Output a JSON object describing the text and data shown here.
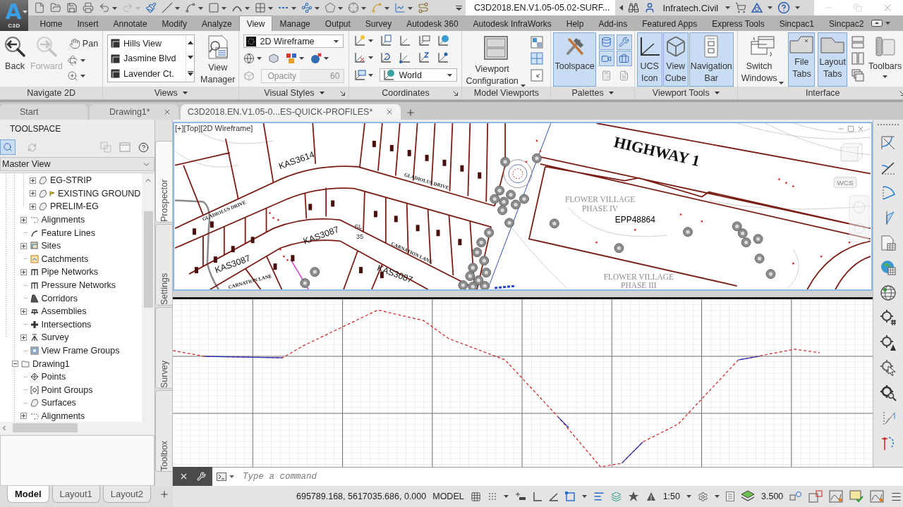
{
  "app_button": {
    "logo": "A",
    "label": "C3D"
  },
  "quick_access": {
    "tools": [
      {
        "kind": "new",
        "menu": false,
        "disabled": false
      },
      {
        "kind": "open",
        "menu": false,
        "disabled": false
      },
      {
        "kind": "save",
        "menu": false,
        "disabled": false
      },
      {
        "kind": "print",
        "menu": false,
        "disabled": false
      },
      {
        "kind": "undo",
        "menu": true,
        "disabled": false
      },
      {
        "kind": "redo",
        "menu": true,
        "disabled": true
      },
      {
        "kind": "match",
        "menu": false,
        "disabled": false
      },
      {
        "kind": "line",
        "menu": true,
        "disabled": false
      },
      {
        "kind": "polyline",
        "menu": true,
        "disabled": false
      },
      {
        "kind": "rectangle",
        "menu": true,
        "disabled": false
      },
      {
        "kind": "arc",
        "menu": true,
        "disabled": false
      },
      {
        "kind": "hatch",
        "menu": true,
        "disabled": false
      },
      {
        "kind": "dashline",
        "menu": true,
        "disabled": false
      },
      {
        "kind": "nodes",
        "menu": true,
        "disabled": false
      },
      {
        "kind": "surface",
        "menu": true,
        "disabled": false
      },
      {
        "kind": "point",
        "menu": true,
        "disabled": false
      },
      {
        "kind": "curve",
        "menu": true,
        "disabled": false
      },
      {
        "kind": "profile",
        "menu": true,
        "disabled": false
      },
      {
        "kind": "road",
        "menu": false,
        "disabled": false
      }
    ]
  },
  "title_bar": {
    "document_title": "C3D2018.EN.V1.05-05.02-SURF...",
    "user": "Infratech.Civil"
  },
  "ribbon_tabs": [
    {
      "label": "Home",
      "selected": false
    },
    {
      "label": "Insert",
      "selected": false
    },
    {
      "label": "Annotate",
      "selected": false
    },
    {
      "label": "Modify",
      "selected": false
    },
    {
      "label": "Analyze",
      "selected": false
    },
    {
      "label": "View",
      "selected": true
    },
    {
      "label": "Manage",
      "selected": false
    },
    {
      "label": "Output",
      "selected": false
    },
    {
      "label": "Survey",
      "selected": false
    },
    {
      "label": "Autodesk 360",
      "selected": false
    },
    {
      "label": "Autodesk InfraWorks",
      "selected": false
    },
    {
      "label": "Help",
      "selected": false
    },
    {
      "label": "Add-ins",
      "selected": false
    },
    {
      "label": "Featured Apps",
      "selected": false
    },
    {
      "label": "Express Tools",
      "selected": false
    },
    {
      "label": "Sincpac1",
      "selected": false
    },
    {
      "label": "Sincpac2",
      "selected": false
    }
  ],
  "ribbon": {
    "navigate_2d": {
      "title": "Navigate 2D",
      "back": {
        "label": "Back",
        "disabled": false
      },
      "forward": {
        "label": "Forward",
        "disabled": true
      },
      "pan": "Pan"
    },
    "views": {
      "title": "Views",
      "items": [
        "Hills View",
        "Jasmine Blvd",
        "Lavender Ct."
      ],
      "manager": "View Manager"
    },
    "visual_styles": {
      "title": "Visual Styles",
      "style": "2D Wireframe",
      "opacity": {
        "label": "Opacity",
        "value": "60",
        "disabled": true
      }
    },
    "coordinates": {
      "title": "Coordinates",
      "ucs": "World"
    },
    "model_viewports": {
      "title": "Model Viewports",
      "configuration": "Viewport Configuration"
    },
    "palettes": {
      "title": "Palettes",
      "toolspace": {
        "label": "Toolspace",
        "selected": true
      },
      "tools": [
        {
          "kind": "database",
          "selected": true
        },
        {
          "kind": "wrenches",
          "selected": true
        },
        {
          "kind": "camera",
          "selected": true
        },
        {
          "kind": "toolbox",
          "selected": true
        },
        {
          "kind": "calculator",
          "selected": false
        },
        {
          "kind": "sheet",
          "selected": false
        }
      ]
    },
    "viewport_tools": {
      "title": "Viewport Tools",
      "buttons": [
        {
          "label": "UCS Icon",
          "kind": "ucs",
          "selected": true
        },
        {
          "label": "View Cube",
          "kind": "cube",
          "selected": true
        },
        {
          "label": "Navigation Bar",
          "kind": "navbar",
          "selected": true
        }
      ]
    },
    "interface": {
      "title": "Interface",
      "switch_windows": "Switch Windows",
      "tabs": [
        {
          "label": "File Tabs",
          "kind": "file",
          "selected": true
        },
        {
          "label": "Layout Tabs",
          "kind": "layout",
          "selected": true
        }
      ],
      "toolbars": "Toolbars"
    }
  },
  "file_tabs": [
    {
      "label": "Start",
      "selected": false,
      "closable": false
    },
    {
      "label": "Drawing1*",
      "selected": false,
      "closable": true
    },
    {
      "label": "C3D2018.EN.V1.05-0...ES-QUICK-PROFILES*",
      "selected": true,
      "closable": true
    }
  ],
  "toolspace": {
    "title": "TOOLSPACE",
    "view": "Master View",
    "tree": [
      {
        "children": [
          {
            "children": [
              {
                "label": "EG-STRIP",
                "kind": "surface",
                "expanded": false
              },
              {
                "label": "EXISTING GROUND",
                "kind": "flaggedsurface",
                "expanded": false
              },
              {
                "label": "PRELIM-EG",
                "kind": "surface",
                "expanded": false
              }
            ]
          },
          {
            "label": "Alignments",
            "kind": "alignment",
            "expanded": false
          },
          {
            "label": "Feature Lines",
            "kind": "featureline"
          },
          {
            "label": "Sites",
            "kind": "site",
            "expanded": false
          },
          {
            "label": "Catchments",
            "kind": "catchment"
          },
          {
            "label": "Pipe Networks",
            "kind": "pipe",
            "expanded": false
          },
          {
            "label": "Pressure Networks",
            "kind": "pipe"
          },
          {
            "label": "Corridors",
            "kind": "corridor"
          },
          {
            "label": "Assemblies",
            "kind": "assembly",
            "expanded": false
          },
          {
            "label": "Intersections",
            "kind": "intersection"
          },
          {
            "label": "Survey",
            "kind": "survey",
            "expanded": false
          },
          {
            "label": "View Frame Groups",
            "kind": "viewframe"
          }
        ]
      },
      {
        "label": "Drawing1",
        "kind": "drawing",
        "expanded": true,
        "children": [
          {
            "label": "Points",
            "kind": "point"
          },
          {
            "label": "Point Groups",
            "kind": "pointgroup"
          },
          {
            "label": "Surfaces",
            "kind": "surface"
          },
          {
            "label": "Alignments",
            "kind": "alignment",
            "expanded": false
          }
        ]
      }
    ],
    "side_tabs": [
      {
        "label": "Prospector",
        "selected": true
      },
      {
        "label": "Settings",
        "selected": false
      },
      {
        "label": "Survey",
        "selected": false
      },
      {
        "label": "Toolbox",
        "selected": false
      }
    ]
  },
  "viewport": {
    "controls": [
      "[+]",
      "[Top]",
      "[2D Wireframe]"
    ],
    "ucs_label": "WCS",
    "labels": [
      {
        "text": "HIGHWAY 1",
        "kind": "highway"
      },
      {
        "text": "KAS3614",
        "kind": "parcel"
      },
      {
        "text": "GLADIOLUS DRIVE",
        "kind": "street"
      },
      {
        "text": "FLOWER VILLAGE",
        "kind": "area"
      },
      {
        "text": "PHASE IV",
        "kind": "area"
      },
      {
        "text": "GLADIOLUS DRIVE",
        "kind": "street"
      },
      {
        "text": "EPP48864",
        "kind": "plan"
      },
      {
        "text": "SL",
        "kind": "note"
      },
      {
        "text": "KAS3087",
        "kind": "parcel"
      },
      {
        "text": "35",
        "kind": "note"
      },
      {
        "text": "CARNATION LANE",
        "kind": "street"
      },
      {
        "text": "KAS3087",
        "kind": "parcel"
      },
      {
        "text": "KAS3087",
        "kind": "parcel"
      },
      {
        "text": "FLOWER VILLAGE",
        "kind": "area"
      },
      {
        "text": "CARNATION LANE",
        "kind": "street"
      },
      {
        "text": "PHASE III",
        "kind": "area"
      }
    ]
  },
  "command_line": {
    "placeholder": "Type a command"
  },
  "layout_tabs": [
    {
      "label": "Model",
      "selected": true
    },
    {
      "label": "Layout1",
      "selected": false
    },
    {
      "label": "Layout2",
      "selected": false
    }
  ],
  "status_bar": {
    "coordinates": "695789.168, 5617035.686, 0.000",
    "space": "MODEL",
    "scale": "1:50",
    "readout": "3.500"
  }
}
